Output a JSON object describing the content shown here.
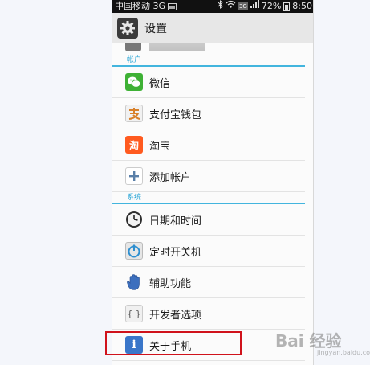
{
  "statusbar": {
    "carrier": "中国移动 3G",
    "network_badge": "3G",
    "battery_percent": "72%",
    "time": "8:50"
  },
  "titlebar": {
    "title": "设置"
  },
  "sections": [
    {
      "header": "帐户",
      "items": [
        {
          "label": "微信",
          "icon": "wechat-icon"
        },
        {
          "label": "支付宝钱包",
          "icon": "alipay-icon"
        },
        {
          "label": "淘宝",
          "icon": "taobao-icon",
          "glyph": "淘"
        },
        {
          "label": "添加帐户",
          "icon": "add-icon"
        }
      ]
    },
    {
      "header": "系统",
      "items": [
        {
          "label": "日期和时间",
          "icon": "clock-icon"
        },
        {
          "label": "定时开关机",
          "icon": "power-timer-icon"
        },
        {
          "label": "辅助功能",
          "icon": "hand-icon"
        },
        {
          "label": "开发者选项",
          "icon": "developer-icon",
          "glyph": "{ }"
        },
        {
          "label": "关于手机",
          "icon": "info-icon",
          "glyph": "i"
        }
      ]
    }
  ],
  "colors": {
    "accent": "#2aa6d6",
    "highlight": "#d0121b",
    "wechat": "#3eb135",
    "taobao": "#ff5a1f"
  },
  "watermark": {
    "main": "Bai 经验",
    "sub": "jingyan.baidu.com"
  }
}
